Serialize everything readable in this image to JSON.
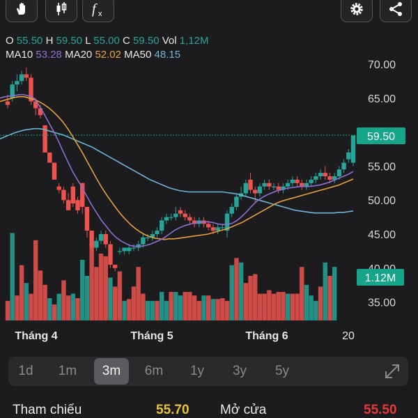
{
  "toolbar": {
    "buttons": [
      {
        "name": "hand-pointer-icon"
      },
      {
        "name": "candlestick-icon"
      },
      {
        "name": "function-icon"
      },
      {
        "name": "gear-icon"
      },
      {
        "name": "share-icon"
      }
    ]
  },
  "ohlc": {
    "open_label": "O",
    "open": "55.50",
    "high_label": "H",
    "high": "59.50",
    "low_label": "L",
    "low": "55.00",
    "close_label": "C",
    "close": "59.50",
    "vol_label": "Vol",
    "vol": "1,12M"
  },
  "ma": {
    "ma10_label": "MA10",
    "ma10": "53.28",
    "ma20_label": "MA20",
    "ma20": "52.02",
    "ma50_label": "MA50",
    "ma50": "48.15"
  },
  "colors": {
    "up": "#26a69a",
    "down": "#ef5350",
    "ma10": "#8e6fd6",
    "ma20": "#e8a23a",
    "ma50": "#6eb5d8",
    "price_tag": "#16a58a"
  },
  "chart_data": {
    "type": "candlestick",
    "x_tick_labels": [
      "Tháng 4",
      "Tháng 5",
      "Tháng 6",
      "20"
    ],
    "y_tick_labels": [
      "70.00",
      "65.00",
      "55.00",
      "50.00",
      "45.00",
      "40.00",
      "35.00"
    ],
    "last_price": "59.50",
    "last_volume": "1.12M",
    "ylim": [
      33,
      71
    ],
    "candles": [
      {
        "o": 64.5,
        "h": 65.5,
        "l": 63.5,
        "c": 64.0
      },
      {
        "o": 65.0,
        "h": 67.5,
        "l": 64.5,
        "c": 67.0
      },
      {
        "o": 67.0,
        "h": 68.5,
        "l": 66.0,
        "c": 67.5
      },
      {
        "o": 67.5,
        "h": 69.0,
        "l": 67.0,
        "c": 68.5
      },
      {
        "o": 68.5,
        "h": 69.5,
        "l": 67.5,
        "c": 68.0
      },
      {
        "o": 68.0,
        "h": 68.5,
        "l": 64.0,
        "c": 64.5
      },
      {
        "o": 64.5,
        "h": 65.0,
        "l": 62.5,
        "c": 63.5
      },
      {
        "o": 63.5,
        "h": 64.0,
        "l": 62.0,
        "c": 62.5
      },
      {
        "o": 61.0,
        "h": 61.0,
        "l": 57.0,
        "c": 57.0
      },
      {
        "o": 57.0,
        "h": 57.0,
        "l": 55.5,
        "c": 55.5
      },
      {
        "o": 55.5,
        "h": 55.5,
        "l": 53.0,
        "c": 53.0
      },
      {
        "o": 52.0,
        "h": 52.5,
        "l": 51.0,
        "c": 51.5
      },
      {
        "o": 51.5,
        "h": 52.0,
        "l": 49.5,
        "c": 50.0
      },
      {
        "o": 50.0,
        "h": 51.0,
        "l": 48.5,
        "c": 48.5
      },
      {
        "o": 52.0,
        "h": 52.5,
        "l": 49.0,
        "c": 49.5
      },
      {
        "o": 50.0,
        "h": 50.5,
        "l": 48.0,
        "c": 48.5
      },
      {
        "o": 52.5,
        "h": 52.5,
        "l": 48.0,
        "c": 49.0
      },
      {
        "o": 49.0,
        "h": 49.0,
        "l": 44.5,
        "c": 45.5
      },
      {
        "o": 45.5,
        "h": 45.5,
        "l": 42.5,
        "c": 43.0
      },
      {
        "o": 43.0,
        "h": 44.5,
        "l": 42.5,
        "c": 44.0
      },
      {
        "o": 44.0,
        "h": 45.5,
        "l": 43.5,
        "c": 45.0
      },
      {
        "o": 45.0,
        "h": 45.5,
        "l": 43.0,
        "c": 43.5
      },
      {
        "o": 43.5,
        "h": 44.0,
        "l": 40.0,
        "c": 40.5
      },
      {
        "o": 40.5,
        "h": 40.5,
        "l": 39.5,
        "c": 40.0
      },
      {
        "o": 42.5,
        "h": 43.0,
        "l": 42.0,
        "c": 42.5
      },
      {
        "o": 42.5,
        "h": 43.0,
        "l": 42.0,
        "c": 43.0
      },
      {
        "o": 42.5,
        "h": 43.5,
        "l": 42.0,
        "c": 43.0
      },
      {
        "o": 43.0,
        "h": 43.5,
        "l": 42.5,
        "c": 43.0
      },
      {
        "o": 43.0,
        "h": 44.0,
        "l": 42.5,
        "c": 43.5
      },
      {
        "o": 43.5,
        "h": 45.0,
        "l": 43.0,
        "c": 44.5
      },
      {
        "o": 44.5,
        "h": 45.0,
        "l": 44.0,
        "c": 44.5
      },
      {
        "o": 44.5,
        "h": 45.5,
        "l": 44.0,
        "c": 45.0
      },
      {
        "o": 45.0,
        "h": 46.0,
        "l": 44.5,
        "c": 45.5
      },
      {
        "o": 45.5,
        "h": 47.5,
        "l": 45.0,
        "c": 47.0
      },
      {
        "o": 47.0,
        "h": 48.0,
        "l": 46.5,
        "c": 47.5
      },
      {
        "o": 47.5,
        "h": 48.0,
        "l": 47.0,
        "c": 47.5
      },
      {
        "o": 47.5,
        "h": 49.0,
        "l": 47.0,
        "c": 48.0
      },
      {
        "o": 48.5,
        "h": 49.0,
        "l": 47.5,
        "c": 48.0
      },
      {
        "o": 48.0,
        "h": 48.5,
        "l": 47.0,
        "c": 47.5
      },
      {
        "o": 47.5,
        "h": 48.0,
        "l": 46.5,
        "c": 47.0
      },
      {
        "o": 47.0,
        "h": 47.5,
        "l": 46.0,
        "c": 46.5
      },
      {
        "o": 46.5,
        "h": 47.5,
        "l": 46.0,
        "c": 47.0
      },
      {
        "o": 47.0,
        "h": 47.5,
        "l": 46.0,
        "c": 46.5
      },
      {
        "o": 46.5,
        "h": 47.0,
        "l": 45.5,
        "c": 46.0
      },
      {
        "o": 46.0,
        "h": 46.5,
        "l": 45.0,
        "c": 45.5
      },
      {
        "o": 45.5,
        "h": 46.5,
        "l": 45.0,
        "c": 46.0
      },
      {
        "o": 46.0,
        "h": 46.5,
        "l": 45.5,
        "c": 46.0
      },
      {
        "o": 45.5,
        "h": 48.5,
        "l": 44.5,
        "c": 48.0
      },
      {
        "o": 48.0,
        "h": 49.5,
        "l": 47.5,
        "c": 49.0
      },
      {
        "o": 49.0,
        "h": 51.0,
        "l": 48.5,
        "c": 50.5
      },
      {
        "o": 50.5,
        "h": 52.0,
        "l": 50.0,
        "c": 51.0
      },
      {
        "o": 51.0,
        "h": 53.0,
        "l": 50.5,
        "c": 52.5
      },
      {
        "o": 53.0,
        "h": 54.0,
        "l": 51.0,
        "c": 51.5
      },
      {
        "o": 51.5,
        "h": 52.0,
        "l": 49.5,
        "c": 51.0
      },
      {
        "o": 51.0,
        "h": 52.5,
        "l": 50.5,
        "c": 52.0
      },
      {
        "o": 52.0,
        "h": 53.0,
        "l": 51.5,
        "c": 52.5
      },
      {
        "o": 52.5,
        "h": 53.0,
        "l": 51.5,
        "c": 52.0
      },
      {
        "o": 52.0,
        "h": 52.5,
        "l": 51.5,
        "c": 52.0
      },
      {
        "o": 52.0,
        "h": 52.5,
        "l": 51.0,
        "c": 51.5
      },
      {
        "o": 51.5,
        "h": 52.5,
        "l": 51.0,
        "c": 52.0
      },
      {
        "o": 52.0,
        "h": 53.0,
        "l": 51.5,
        "c": 52.5
      },
      {
        "o": 52.5,
        "h": 53.5,
        "l": 52.0,
        "c": 53.0
      },
      {
        "o": 53.0,
        "h": 53.5,
        "l": 52.0,
        "c": 52.5
      },
      {
        "o": 52.5,
        "h": 53.0,
        "l": 51.5,
        "c": 52.0
      },
      {
        "o": 52.0,
        "h": 53.0,
        "l": 51.5,
        "c": 52.5
      },
      {
        "o": 52.5,
        "h": 53.5,
        "l": 52.0,
        "c": 53.0
      },
      {
        "o": 53.0,
        "h": 54.0,
        "l": 52.5,
        "c": 53.5
      },
      {
        "o": 53.5,
        "h": 54.5,
        "l": 53.0,
        "c": 54.0
      },
      {
        "o": 54.0,
        "h": 55.0,
        "l": 53.0,
        "c": 53.5
      },
      {
        "o": 53.5,
        "h": 54.0,
        "l": 52.5,
        "c": 53.0
      },
      {
        "o": 53.0,
        "h": 54.0,
        "l": 52.5,
        "c": 53.5
      },
      {
        "o": 53.5,
        "h": 55.0,
        "l": 53.0,
        "c": 54.5
      },
      {
        "o": 54.5,
        "h": 56.0,
        "l": 54.0,
        "c": 55.5
      },
      {
        "o": 56.0,
        "h": 57.5,
        "l": 55.5,
        "c": 57.0
      },
      {
        "o": 55.5,
        "h": 59.5,
        "l": 55.0,
        "c": 59.5
      }
    ],
    "volumes": [
      {
        "v": 0.22,
        "up": false
      },
      {
        "v": 0.98,
        "up": true
      },
      {
        "v": 0.28,
        "up": false
      },
      {
        "v": 0.62,
        "up": false
      },
      {
        "v": 0.42,
        "up": true
      },
      {
        "v": 0.3,
        "up": false
      },
      {
        "v": 0.9,
        "up": false
      },
      {
        "v": 0.56,
        "up": false
      },
      {
        "v": 0.4,
        "up": false
      },
      {
        "v": 0.25,
        "up": true
      },
      {
        "v": 0.18,
        "up": false
      },
      {
        "v": 0.3,
        "up": true
      },
      {
        "v": 0.45,
        "up": false
      },
      {
        "v": 0.28,
        "up": false
      },
      {
        "v": 0.3,
        "up": true
      },
      {
        "v": 0.25,
        "up": false
      },
      {
        "v": 0.68,
        "up": true
      },
      {
        "v": 0.5,
        "up": true
      },
      {
        "v": 0.82,
        "up": false
      },
      {
        "v": 0.6,
        "up": false
      },
      {
        "v": 0.75,
        "up": false
      },
      {
        "v": 0.72,
        "up": false
      },
      {
        "v": 0.48,
        "up": true
      },
      {
        "v": 0.38,
        "up": false
      },
      {
        "v": 0.55,
        "up": false
      },
      {
        "v": 0.22,
        "up": true
      },
      {
        "v": 0.24,
        "up": false
      },
      {
        "v": 0.38,
        "up": false
      },
      {
        "v": 0.6,
        "up": false
      },
      {
        "v": 0.3,
        "up": false
      },
      {
        "v": 0.22,
        "up": true
      },
      {
        "v": 0.22,
        "up": true
      },
      {
        "v": 0.22,
        "up": false
      },
      {
        "v": 0.32,
        "up": true
      },
      {
        "v": 0.22,
        "up": true
      },
      {
        "v": 0.32,
        "up": false
      },
      {
        "v": 0.32,
        "up": true
      },
      {
        "v": 0.28,
        "up": true
      },
      {
        "v": 0.32,
        "up": false
      },
      {
        "v": 0.32,
        "up": false
      },
      {
        "v": 0.28,
        "up": false
      },
      {
        "v": 0.22,
        "up": false
      },
      {
        "v": 0.28,
        "up": true
      },
      {
        "v": 0.28,
        "up": false
      },
      {
        "v": 0.24,
        "up": true
      },
      {
        "v": 0.24,
        "up": false
      },
      {
        "v": 0.25,
        "up": false
      },
      {
        "v": 0.22,
        "up": false
      },
      {
        "v": 0.62,
        "up": true
      },
      {
        "v": 0.7,
        "up": false
      },
      {
        "v": 0.65,
        "up": true
      },
      {
        "v": 0.42,
        "up": false
      },
      {
        "v": 0.5,
        "up": false
      },
      {
        "v": 0.52,
        "up": false
      },
      {
        "v": 0.3,
        "up": false
      },
      {
        "v": 0.3,
        "up": false
      },
      {
        "v": 0.34,
        "up": false
      },
      {
        "v": 0.3,
        "up": false
      },
      {
        "v": 0.32,
        "up": false
      },
      {
        "v": 0.32,
        "up": false
      },
      {
        "v": 0.3,
        "up": true
      },
      {
        "v": 0.3,
        "up": false
      },
      {
        "v": 0.3,
        "up": false
      },
      {
        "v": 0.6,
        "up": false
      },
      {
        "v": 0.4,
        "up": true
      },
      {
        "v": 0.28,
        "up": true
      },
      {
        "v": 0.22,
        "up": true
      },
      {
        "v": 0.38,
        "up": false
      },
      {
        "v": 0.65,
        "up": true
      },
      {
        "v": 0.5,
        "up": false
      },
      {
        "v": 0.6,
        "up": true
      }
    ],
    "ma10": [
      65.0,
      65.2,
      65.3,
      65.4,
      65.5,
      65.5,
      65.3,
      65.0,
      64.0,
      62.8,
      61.5,
      60.2,
      58.8,
      57.2,
      55.7,
      54.2,
      53.0,
      51.8,
      50.5,
      49.2,
      48.1,
      47.0,
      46.1,
      45.2,
      44.5,
      44.0,
      43.6,
      43.3,
      43.2,
      43.2,
      43.3,
      43.5,
      43.8,
      44.1,
      44.5,
      45.0,
      45.5,
      45.9,
      46.2,
      46.4,
      46.6,
      46.7,
      46.8,
      46.8,
      46.7,
      46.5,
      46.4,
      46.4,
      46.6,
      47.0,
      47.6,
      48.3,
      49.1,
      49.8,
      50.3,
      50.7,
      51.0,
      51.3,
      51.5,
      51.7,
      51.8,
      51.9,
      52.0,
      52.0,
      52.0,
      52.1,
      52.2,
      52.4,
      52.6,
      52.9,
      53.2,
      53.5,
      53.8,
      54.2
    ],
    "ma20": [
      64.5,
      64.7,
      64.9,
      65.1,
      65.2,
      65.2,
      65.0,
      64.8,
      64.5,
      64.1,
      63.6,
      63.0,
      62.3,
      61.5,
      60.5,
      59.4,
      58.2,
      57.0,
      55.7,
      54.4,
      53.1,
      51.9,
      50.8,
      49.8,
      48.8,
      47.9,
      47.1,
      46.4,
      45.8,
      45.3,
      44.9,
      44.6,
      44.4,
      44.3,
      44.2,
      44.3,
      44.3,
      44.4,
      44.5,
      44.6,
      44.7,
      44.8,
      44.9,
      45.0,
      45.2,
      45.4,
      45.6,
      45.8,
      46.1,
      46.4,
      46.7,
      47.1,
      47.5,
      47.9,
      48.3,
      48.7,
      49.1,
      49.5,
      49.8,
      50.0,
      50.2,
      50.4,
      50.6,
      50.8,
      51.0,
      51.2,
      51.4,
      51.6,
      51.8,
      52.0,
      52.2,
      52.5,
      52.8,
      53.1
    ],
    "ma50": [
      59.0,
      59.3,
      59.6,
      59.9,
      60.1,
      60.3,
      60.4,
      60.5,
      60.5,
      60.4,
      60.2,
      60.0,
      59.8,
      59.6,
      59.3,
      59.0,
      58.7,
      58.4,
      58.1,
      57.8,
      57.4,
      57.0,
      56.6,
      56.2,
      55.8,
      55.4,
      55.0,
      54.6,
      54.2,
      53.8,
      53.4,
      53.0,
      52.7,
      52.4,
      52.1,
      51.8,
      51.6,
      51.4,
      51.3,
      51.2,
      51.2,
      51.2,
      51.2,
      51.2,
      51.2,
      51.2,
      51.2,
      51.1,
      51.0,
      50.9,
      50.7,
      50.5,
      50.3,
      50.1,
      49.9,
      49.7,
      49.5,
      49.3,
      49.1,
      48.9,
      48.7,
      48.5,
      48.4,
      48.3,
      48.2,
      48.1,
      48.1,
      48.1,
      48.1,
      48.1,
      48.2,
      48.2,
      48.3,
      48.4
    ]
  },
  "periods": [
    {
      "label": "1d"
    },
    {
      "label": "1m"
    },
    {
      "label": "3m",
      "active": true
    },
    {
      "label": "6m"
    },
    {
      "label": "1y"
    },
    {
      "label": "3y"
    },
    {
      "label": "5y"
    }
  ],
  "footer": {
    "ref_label": "Tham chiếu",
    "ref_value": "55.70",
    "open_label": "Mở cửa",
    "open_value": "55.50"
  }
}
